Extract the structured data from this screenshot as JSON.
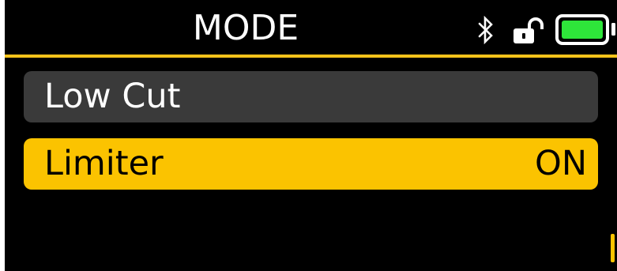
{
  "header": {
    "title": "MODE",
    "icons": [
      "bluetooth-icon",
      "unlocked-padlock-icon",
      "battery-icon"
    ],
    "battery_level": 1.0
  },
  "menu": {
    "items": [
      {
        "label": "Low Cut",
        "value": "",
        "selected": false
      },
      {
        "label": "Limiter",
        "value": "ON",
        "selected": true
      }
    ]
  },
  "colors": {
    "background": "#000000",
    "accent": "#fbc300",
    "item_background": "#3a3a3a",
    "battery_fill": "#2ee53a",
    "text_primary": "#ffffff",
    "text_on_accent": "#000000"
  }
}
